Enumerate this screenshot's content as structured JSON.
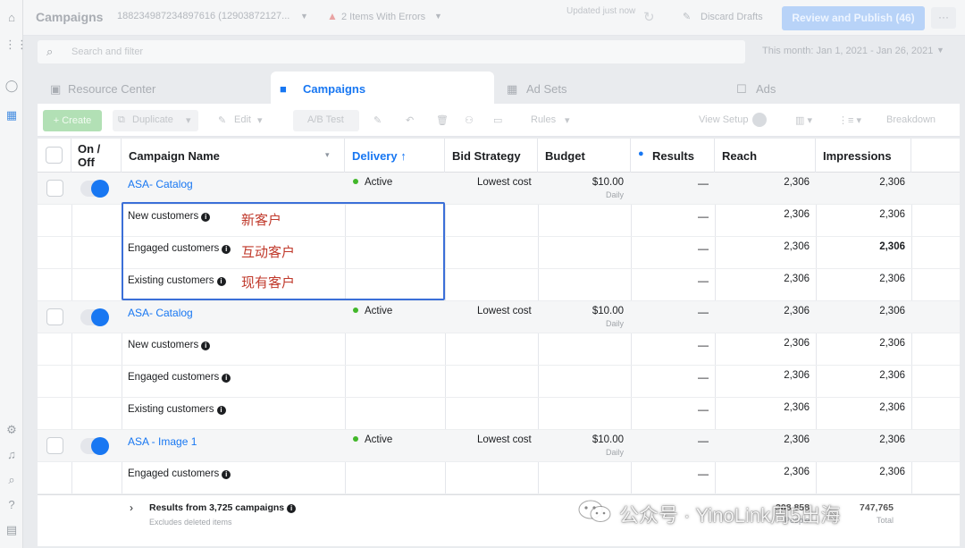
{
  "header": {
    "title": "Campaigns",
    "account": "188234987234897616 (12903872127...",
    "errors_label": "2 Items With Errors",
    "updated": "Updated just now",
    "discard_label": "Discard Drafts",
    "review_label": "Review and Publish (46)",
    "more_label": "···"
  },
  "search": {
    "placeholder": "Search and filter",
    "date_range": "This month: Jan 1, 2021 - Jan 26, 2021"
  },
  "tabs": [
    {
      "label": "Resource Center",
      "icon": "resource-center-icon"
    },
    {
      "label": "Campaigns",
      "icon": "campaigns-folder-icon",
      "active": true
    },
    {
      "label": "Ad Sets",
      "icon": "ad-sets-grid-icon"
    },
    {
      "label": "Ads",
      "icon": "ads-square-icon"
    }
  ],
  "toolbar": {
    "create": "+ Create",
    "duplicate": "Duplicate",
    "edit": "Edit",
    "ab_test": "A/B Test",
    "rules": "Rules",
    "view_setup": "View Setup",
    "breakdown": "Breakdown"
  },
  "columns": {
    "onoff": "On / Off",
    "name": "Campaign Name",
    "delivery": "Delivery ↑",
    "bid": "Bid Strategy",
    "budget": "Budget",
    "results": "Results",
    "reach": "Reach",
    "impressions": "Impressions"
  },
  "rows": [
    {
      "type": "campaign",
      "name": "ASA- Catalog",
      "delivery": "Active",
      "bid": "Lowest cost",
      "budget": "$10.00",
      "budget_sub": "Daily",
      "results": "—",
      "reach": "2,306",
      "impressions": "2,306"
    },
    {
      "type": "audience",
      "name": "New customers",
      "cn": "新客户",
      "results": "—",
      "reach": "2,306",
      "impressions": "2,306"
    },
    {
      "type": "audience",
      "name": "Engaged customers",
      "cn": "互动客户",
      "results": "—",
      "reach": "2,306",
      "impressions": "2,306"
    },
    {
      "type": "audience",
      "name": "Existing customers",
      "cn": "现有客户",
      "results": "—",
      "reach": "2,306",
      "impressions": "2,306"
    },
    {
      "type": "campaign",
      "name": "ASA- Catalog",
      "delivery": "Active",
      "bid": "Lowest cost",
      "budget": "$10.00",
      "budget_sub": "Daily",
      "results": "—",
      "reach": "2,306",
      "impressions": "2,306"
    },
    {
      "type": "audience",
      "name": "New customers",
      "results": "—",
      "reach": "2,306",
      "impressions": "2,306"
    },
    {
      "type": "audience",
      "name": "Engaged customers",
      "results": "—",
      "reach": "2,306",
      "impressions": "2,306"
    },
    {
      "type": "audience",
      "name": "Existing customers",
      "results": "—",
      "reach": "2,306",
      "impressions": "2,306"
    },
    {
      "type": "campaign",
      "name": "ASA - Image 1",
      "delivery": "Active",
      "bid": "Lowest cost",
      "budget": "$10.00",
      "budget_sub": "Daily",
      "results": "—",
      "reach": "2,306",
      "impressions": "2,306"
    },
    {
      "type": "audience",
      "name": "Engaged customers",
      "results": "—",
      "reach": "2,306",
      "impressions": "2,306"
    }
  ],
  "footer": {
    "main": "Results from 3,725 campaigns",
    "sub": "Excludes deleted items",
    "reach": "308,858",
    "reach_sub": "People",
    "impressions": "747,765",
    "impressions_sub": "Total"
  },
  "watermark": {
    "text": "公众号 · YinoLink周5出海"
  },
  "colors": {
    "accent": "#1877f2",
    "active_dot": "#42b72a",
    "annotation": "#c0392b",
    "highlight_border": "#3b6fd8"
  }
}
